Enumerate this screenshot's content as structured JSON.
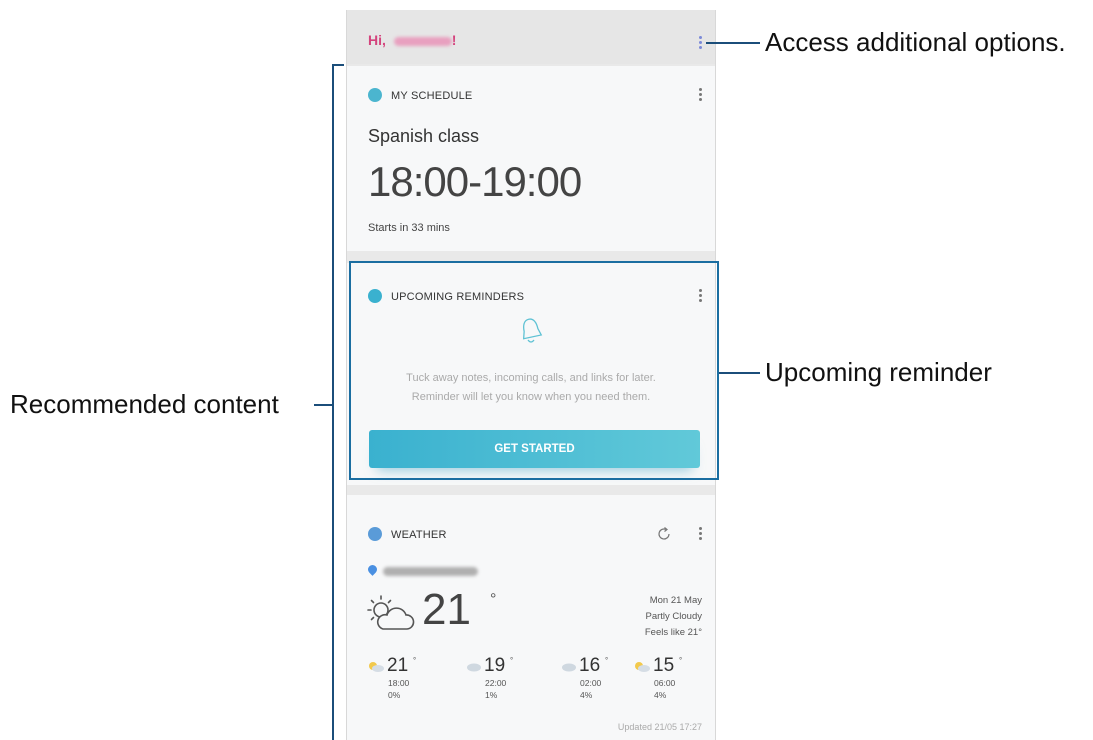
{
  "header": {
    "greeting": "Hi, ",
    "greeting_end": "!"
  },
  "schedule": {
    "title": "MY SCHEDULE",
    "event": "Spanish class",
    "time": "18:00-19:00",
    "subtitle": "Starts in 33 mins"
  },
  "reminders": {
    "title": "UPCOMING REMINDERS",
    "message_line1": "Tuck away notes, incoming calls, and links for later.",
    "message_line2": "Reminder will let you know when you need them.",
    "button": "GET STARTED"
  },
  "weather": {
    "title": "WEATHER",
    "temperature": "21",
    "degree": "°",
    "date": "Mon 21 May",
    "condition": "Partly Cloudy",
    "feels_like": "Feels like 21°",
    "forecast": [
      {
        "temp": "21",
        "time": "18:00",
        "precip": "0%",
        "icon": "sun-cloud-icon"
      },
      {
        "temp": "19",
        "time": "22:00",
        "precip": "1%",
        "icon": "cloud-icon"
      },
      {
        "temp": "16",
        "time": "02:00",
        "precip": "4%",
        "icon": "cloud-icon"
      },
      {
        "temp": "15",
        "time": "06:00",
        "precip": "4%",
        "icon": "sun-cloud-icon"
      }
    ],
    "updated": "Updated 21/05 17:27"
  },
  "callouts": {
    "options": "Access additional options.",
    "reminder": "Upcoming reminder",
    "recommended": "Recommended content"
  },
  "colors": {
    "greeting": "#d4447d",
    "accent": "#3ab1cf",
    "callout_line": "#1b4e7a"
  }
}
